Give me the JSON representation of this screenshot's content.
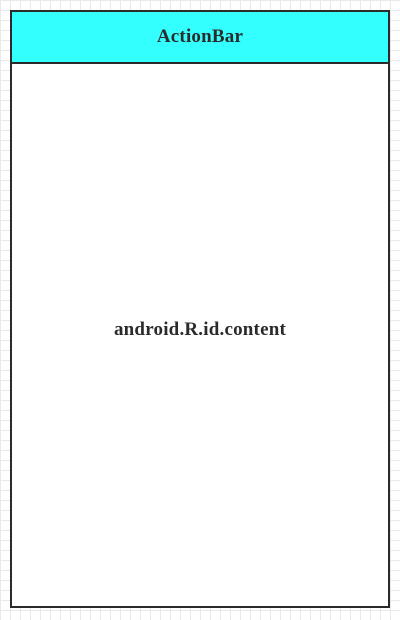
{
  "colors": {
    "action_bar_fill": "#33ffff",
    "content_fill": "#ffffff",
    "border": "#2b2b2b",
    "text": "#2b2b2b"
  },
  "action_bar": {
    "label": "ActionBar"
  },
  "content": {
    "label": "android.R.id.content"
  }
}
